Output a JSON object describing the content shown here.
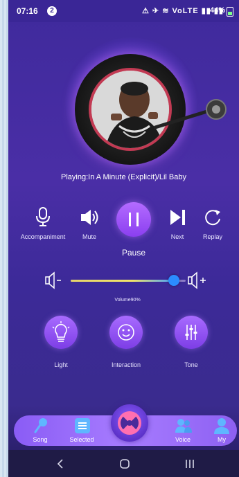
{
  "status_bar": {
    "time": "07:16",
    "notification_count": "2",
    "system_icons_text": "⚠ ✈ ≋ VoLTE ▮▮ ▮▮",
    "battery": "44%"
  },
  "player": {
    "now_playing": "Playing:In A Minute (Explicit)/Lil Baby",
    "controls": {
      "accompaniment": "Accompaniment",
      "mute": "Mute",
      "pause": "Pause",
      "next": "Next",
      "replay": "Replay"
    },
    "volume": {
      "label": "Volume90%",
      "level": 0.9
    }
  },
  "features": {
    "light": "Light",
    "interaction": "Interaction",
    "tone": "Tone"
  },
  "bottom_nav": {
    "song": "Song",
    "selected": "Selected",
    "voice": "Voice",
    "my": "My"
  },
  "icons": {
    "accompaniment": "microphone-icon",
    "mute": "speaker-icon",
    "pause": "pause-icon",
    "next": "skip-next-icon",
    "replay": "replay-icon",
    "volume_down": "volume-down-icon",
    "volume_up": "volume-up-icon",
    "light": "lightbulb-icon",
    "interaction": "smiley-icon",
    "tone": "equalizer-icon"
  },
  "colors": {
    "background": "#4a2ea6",
    "accent": "#a86bff",
    "volume_knob": "#2b8cff"
  }
}
